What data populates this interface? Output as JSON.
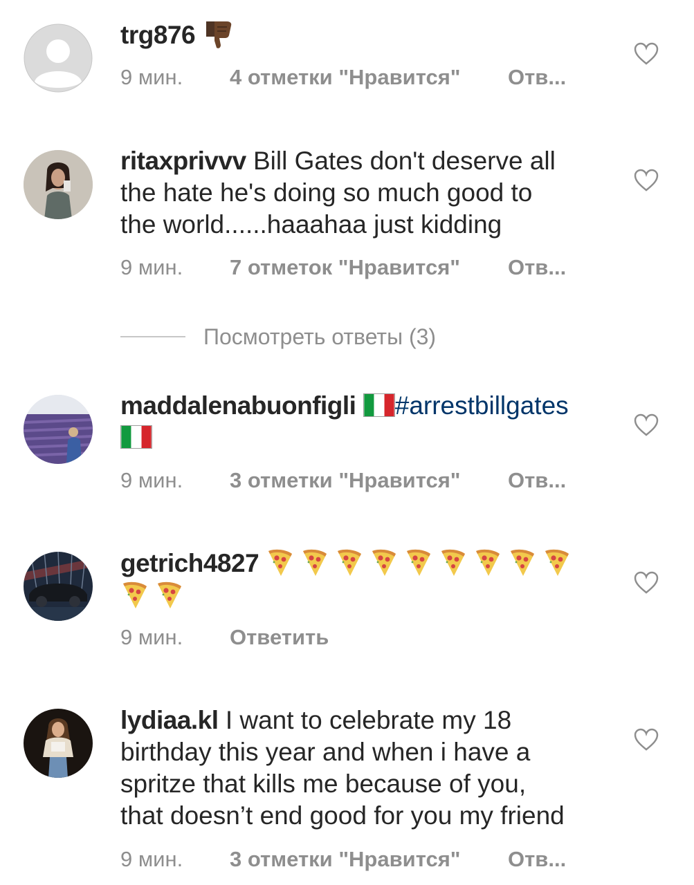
{
  "comments": [
    {
      "username": "trg876",
      "text": "",
      "emoji": "thumbs-down",
      "time": "9 мин.",
      "likes": "4 отметки \"Нравится\"",
      "reply": "Отв..."
    },
    {
      "username": "ritaxprivvv",
      "text_lines": [
        "Bill Gates don't deserve all",
        "the hate  he's doing so much good to",
        "the world......haaahaa just kidding"
      ],
      "time": "9 мин.",
      "likes": "7 отметок \"Нравится\"",
      "reply": "Отв..."
    },
    {
      "username": "maddalenabuonfigli",
      "hashtag": "#arrestbillgates",
      "emoji": "italian-flag",
      "time": "9 мин.",
      "likes": "3 отметки \"Нравится\"",
      "reply": "Отв..."
    },
    {
      "username": "getrich4827",
      "emoji": "pizza",
      "emoji_count": 11,
      "time": "9 мин.",
      "reply": "Ответить"
    },
    {
      "username": "lydiaa.kl",
      "text_lines": [
        "I want to celebrate my 18",
        "birthday this year and when i have a",
        "spritze that kills me because of you,",
        "that doesn’t end good for you my friend"
      ],
      "time": "9 мин.",
      "likes": "3 отметки \"Нравится\"",
      "reply": "Отв..."
    }
  ],
  "view_replies": "Посмотреть ответы (3)",
  "colors": {
    "text": "#262626",
    "meta": "#8e8e8e",
    "hashtag": "#003569",
    "divider": "#c7c7c7"
  }
}
